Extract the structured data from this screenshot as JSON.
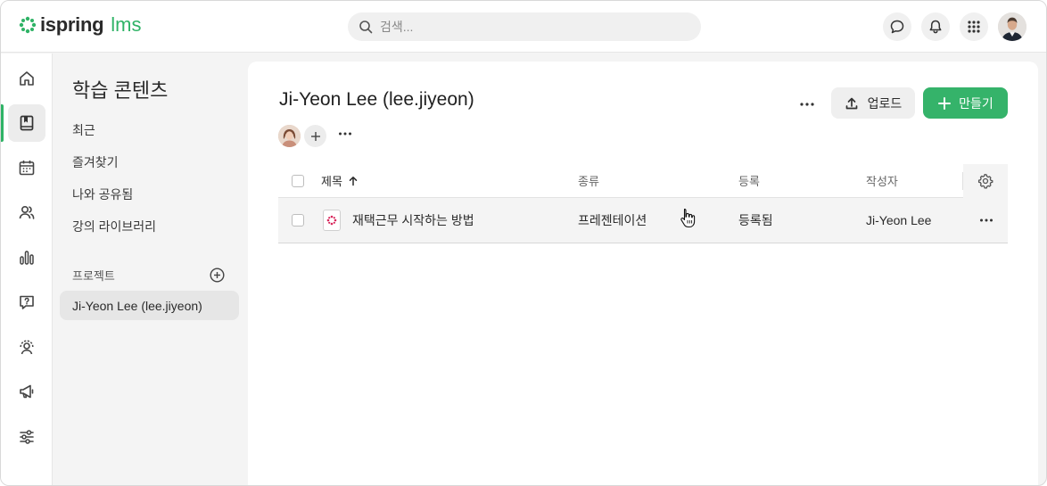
{
  "brand": {
    "name": "ispring",
    "suffix": "lms",
    "accent": "#2fb366"
  },
  "search": {
    "placeholder": "검색..."
  },
  "topbar": {
    "icons": [
      "chat-icon",
      "bell-icon",
      "apps-grid-icon",
      "user-avatar"
    ]
  },
  "rail": {
    "items": [
      "home-icon",
      "book-icon",
      "calendar-icon",
      "users-icon",
      "chart-icon",
      "help-icon",
      "coach-icon",
      "megaphone-icon",
      "settings-sliders-icon"
    ],
    "active_index": 1
  },
  "sidebar": {
    "title": "학습 콘텐츠",
    "links": [
      "최근",
      "즐겨찾기",
      "나와 공유됨",
      "강의 라이브러리"
    ],
    "projects_label": "프로젝트",
    "project_selected": "Ji-Yeon Lee (lee.jiyeon)"
  },
  "main": {
    "title": "Ji-Yeon Lee (lee.jiyeon)",
    "upload_label": "업로드",
    "create_label": "만들기",
    "columns": {
      "title": "제목",
      "type": "종류",
      "status": "등록",
      "author": "작성자"
    },
    "rows": [
      {
        "title": "재택근무 시작하는 방법",
        "type": "프레젠테이션",
        "status": "등록됨",
        "author": "Ji-Yeon Lee"
      }
    ]
  }
}
